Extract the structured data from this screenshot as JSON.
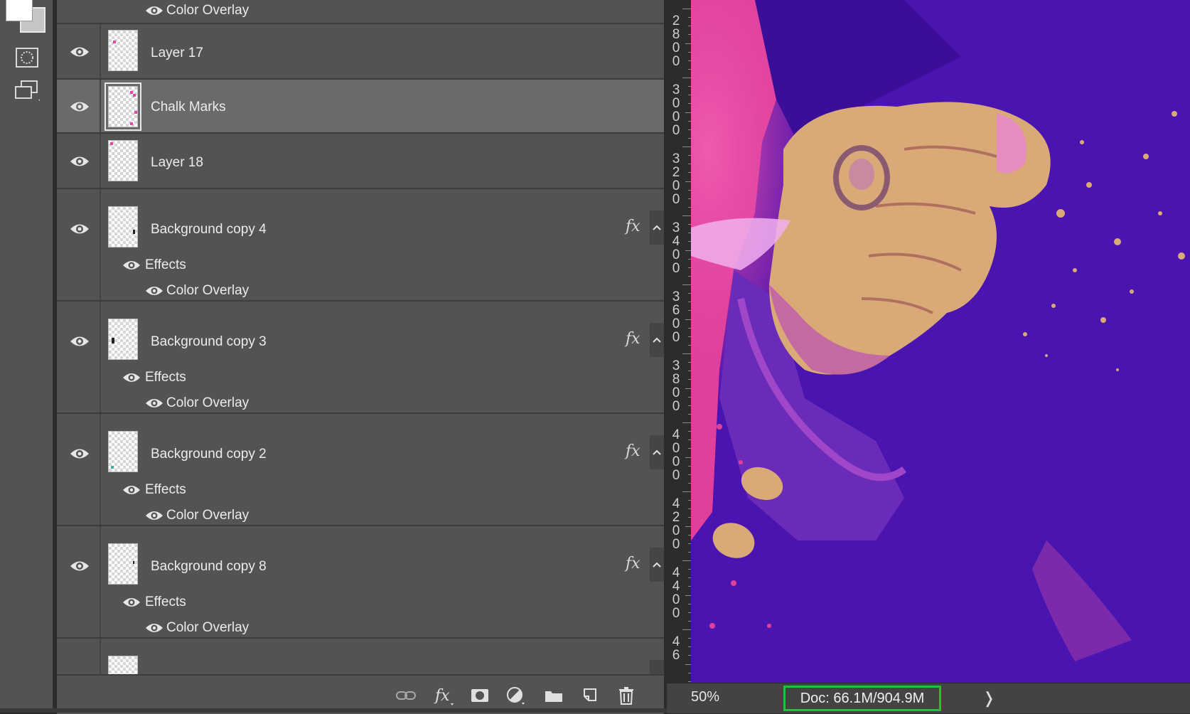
{
  "tools": {
    "foreground_color": "#ffffff",
    "background_color": "#c5c5c5",
    "icons": [
      "quick-mask-icon",
      "screen-mode-icon"
    ]
  },
  "layers": {
    "top_partial": {
      "sub_label": "Color Overlay"
    },
    "items": [
      {
        "name": "Layer 17",
        "visible": true,
        "selected": false
      },
      {
        "name": "Chalk Marks",
        "visible": true,
        "selected": true
      },
      {
        "name": "Layer 18",
        "visible": true,
        "selected": false
      },
      {
        "name": "Background copy 4",
        "visible": true,
        "fx": "fx",
        "effects_label": "Effects",
        "effect": "Color Overlay"
      },
      {
        "name": "Background copy 3",
        "visible": true,
        "fx": "fx",
        "effects_label": "Effects",
        "effect": "Color Overlay"
      },
      {
        "name": "Background copy 2",
        "visible": true,
        "fx": "fx",
        "effects_label": "Effects",
        "effect": "Color Overlay"
      },
      {
        "name": "Background copy 8",
        "visible": true,
        "fx": "fx",
        "effects_label": "Effects",
        "effect": "Color Overlay"
      }
    ],
    "footer_icons": [
      "link-icon",
      "fx-icon",
      "mask-icon",
      "adjustment-icon",
      "folder-icon",
      "new-layer-icon",
      "trash-icon"
    ]
  },
  "ruler": {
    "labels": [
      "2800",
      "3000",
      "3200",
      "3400",
      "3600",
      "3800",
      "4000",
      "4200",
      "4400",
      "46"
    ]
  },
  "status": {
    "zoom": "50%",
    "doc": "Doc: 66.1M/904.9M",
    "arrow": "❭"
  },
  "colors": {
    "panel": "#535353",
    "selected_row": "#6a6a6a",
    "highlight_box": "#22c332",
    "canvas_purple": "#4a14b0",
    "canvas_pink": "#e0409c",
    "canvas_skin": "#d9a978"
  }
}
